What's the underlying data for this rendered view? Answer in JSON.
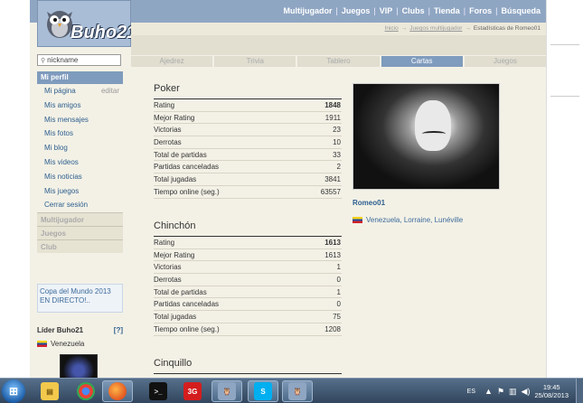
{
  "header": {
    "logo_text": "Buho21",
    "nav": [
      "Multijugador",
      "Juegos",
      "VIP",
      "Clubs",
      "Tienda",
      "Foros",
      "Búsqueda"
    ]
  },
  "breadcrumb": {
    "items": [
      "Inicio",
      "Juegos multijugador"
    ],
    "current": "Estadísticas de Romeo01"
  },
  "sidebar": {
    "search_value": "nickname",
    "profile_header": "Mi perfil",
    "items": [
      {
        "label": "Mi página",
        "extra": "editar"
      },
      {
        "label": "Mis amigos"
      },
      {
        "label": "Mis mensajes"
      },
      {
        "label": "Mis fotos"
      },
      {
        "label": "Mi blog"
      },
      {
        "label": "Mis videos"
      },
      {
        "label": "Mis noticias"
      },
      {
        "label": "Mis juegos"
      },
      {
        "label": "Cerrar sesión"
      }
    ],
    "categories": [
      "Multijugador",
      "Juegos",
      "Club"
    ],
    "promo": "Copa del Mundo 2013 EN DIRECTO!..",
    "leader_title": "Líder Buho21",
    "leader_help": "[?]",
    "leader_country": "Venezuela"
  },
  "tabs": [
    "Ajedrez",
    "Trivia",
    "Tablero",
    "Cartas",
    "Juegos"
  ],
  "active_tab": "Cartas",
  "sections": [
    {
      "title": "Poker",
      "rows": [
        {
          "label": "Rating",
          "value": "1848"
        },
        {
          "label": "Mejor Rating",
          "value": "1911"
        },
        {
          "label": "Victorias",
          "value": "23"
        },
        {
          "label": "Derrotas",
          "value": "10"
        },
        {
          "label": "Total de partidas",
          "value": "33"
        },
        {
          "label": "Partidas canceladas",
          "value": "2"
        },
        {
          "label": "Total jugadas",
          "value": "3841"
        },
        {
          "label": "Tiempo online (seg.)",
          "value": "63557"
        }
      ]
    },
    {
      "title": "Chinchón",
      "rows": [
        {
          "label": "Rating",
          "value": "1613"
        },
        {
          "label": "Mejor Rating",
          "value": "1613"
        },
        {
          "label": "Victorias",
          "value": "1"
        },
        {
          "label": "Derrotas",
          "value": "0"
        },
        {
          "label": "Total de partidas",
          "value": "1"
        },
        {
          "label": "Partidas canceladas",
          "value": "0"
        },
        {
          "label": "Total jugadas",
          "value": "75"
        },
        {
          "label": "Tiempo online (seg.)",
          "value": "1208"
        }
      ]
    },
    {
      "title": "Cinquillo",
      "rows": []
    }
  ],
  "profile": {
    "name": "Romeo01",
    "location": "Venezuela, Lorraine, Lunéville"
  },
  "taskbar": {
    "apps": [
      "file-explorer",
      "chrome",
      "firefox",
      "terminal",
      "3g-modem",
      "buho21",
      "skype",
      "buho21"
    ],
    "language": "ES",
    "time": "19:45",
    "date": "25/08/2013"
  },
  "colors": {
    "accent": "#7f9bbd",
    "link": "#2e5f8f",
    "background": "#f3f1e6"
  }
}
